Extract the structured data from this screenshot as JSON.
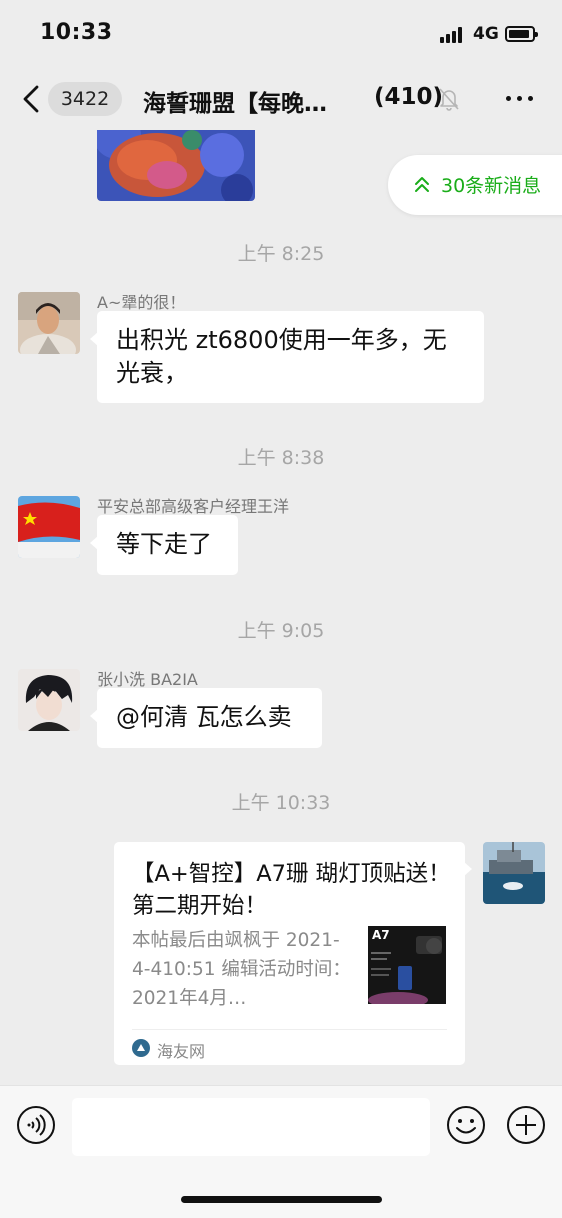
{
  "status_bar": {
    "time": "10:33",
    "network": "4G"
  },
  "nav": {
    "unread_count": "3422",
    "title": "海誓珊盟【每晚…",
    "member_count": "(410)"
  },
  "new_messages": {
    "label": "30条新消息"
  },
  "messages": [
    {
      "timestamp": "上午 8:25",
      "sender": "A~犟的很！",
      "text": "出积光 zt6800使用一年多，无光衰，",
      "avatar": "avatar-man"
    },
    {
      "timestamp": "上午 8:38",
      "sender": "平安总部高级客户经理王洋",
      "text": "等下走了",
      "avatar": "avatar-flag"
    },
    {
      "timestamp": "上午 9:05",
      "sender": "张小洗 BA2IA",
      "text": "@何清 瓦怎么卖",
      "avatar": "avatar-anime"
    }
  ],
  "link_message": {
    "timestamp": "上午 10:33",
    "title": "【A+智控】A7珊 瑚灯顶贴送！第二期开始！",
    "description": "本帖最后由飒枫于 2021-4-410:51 编辑活动时间：2021年4月…",
    "thumb_label": "A7",
    "source": "海友网"
  },
  "input": {
    "placeholder": ""
  },
  "icons": {
    "back": "chevron-left-icon",
    "mute": "bell-slash-icon",
    "more": "more-icon",
    "voice": "voice-icon",
    "emoji": "emoji-icon",
    "plus": "plus-icon"
  },
  "colors": {
    "background": "#ededed",
    "accent_green": "#1aad19",
    "bubble": "#ffffff"
  }
}
